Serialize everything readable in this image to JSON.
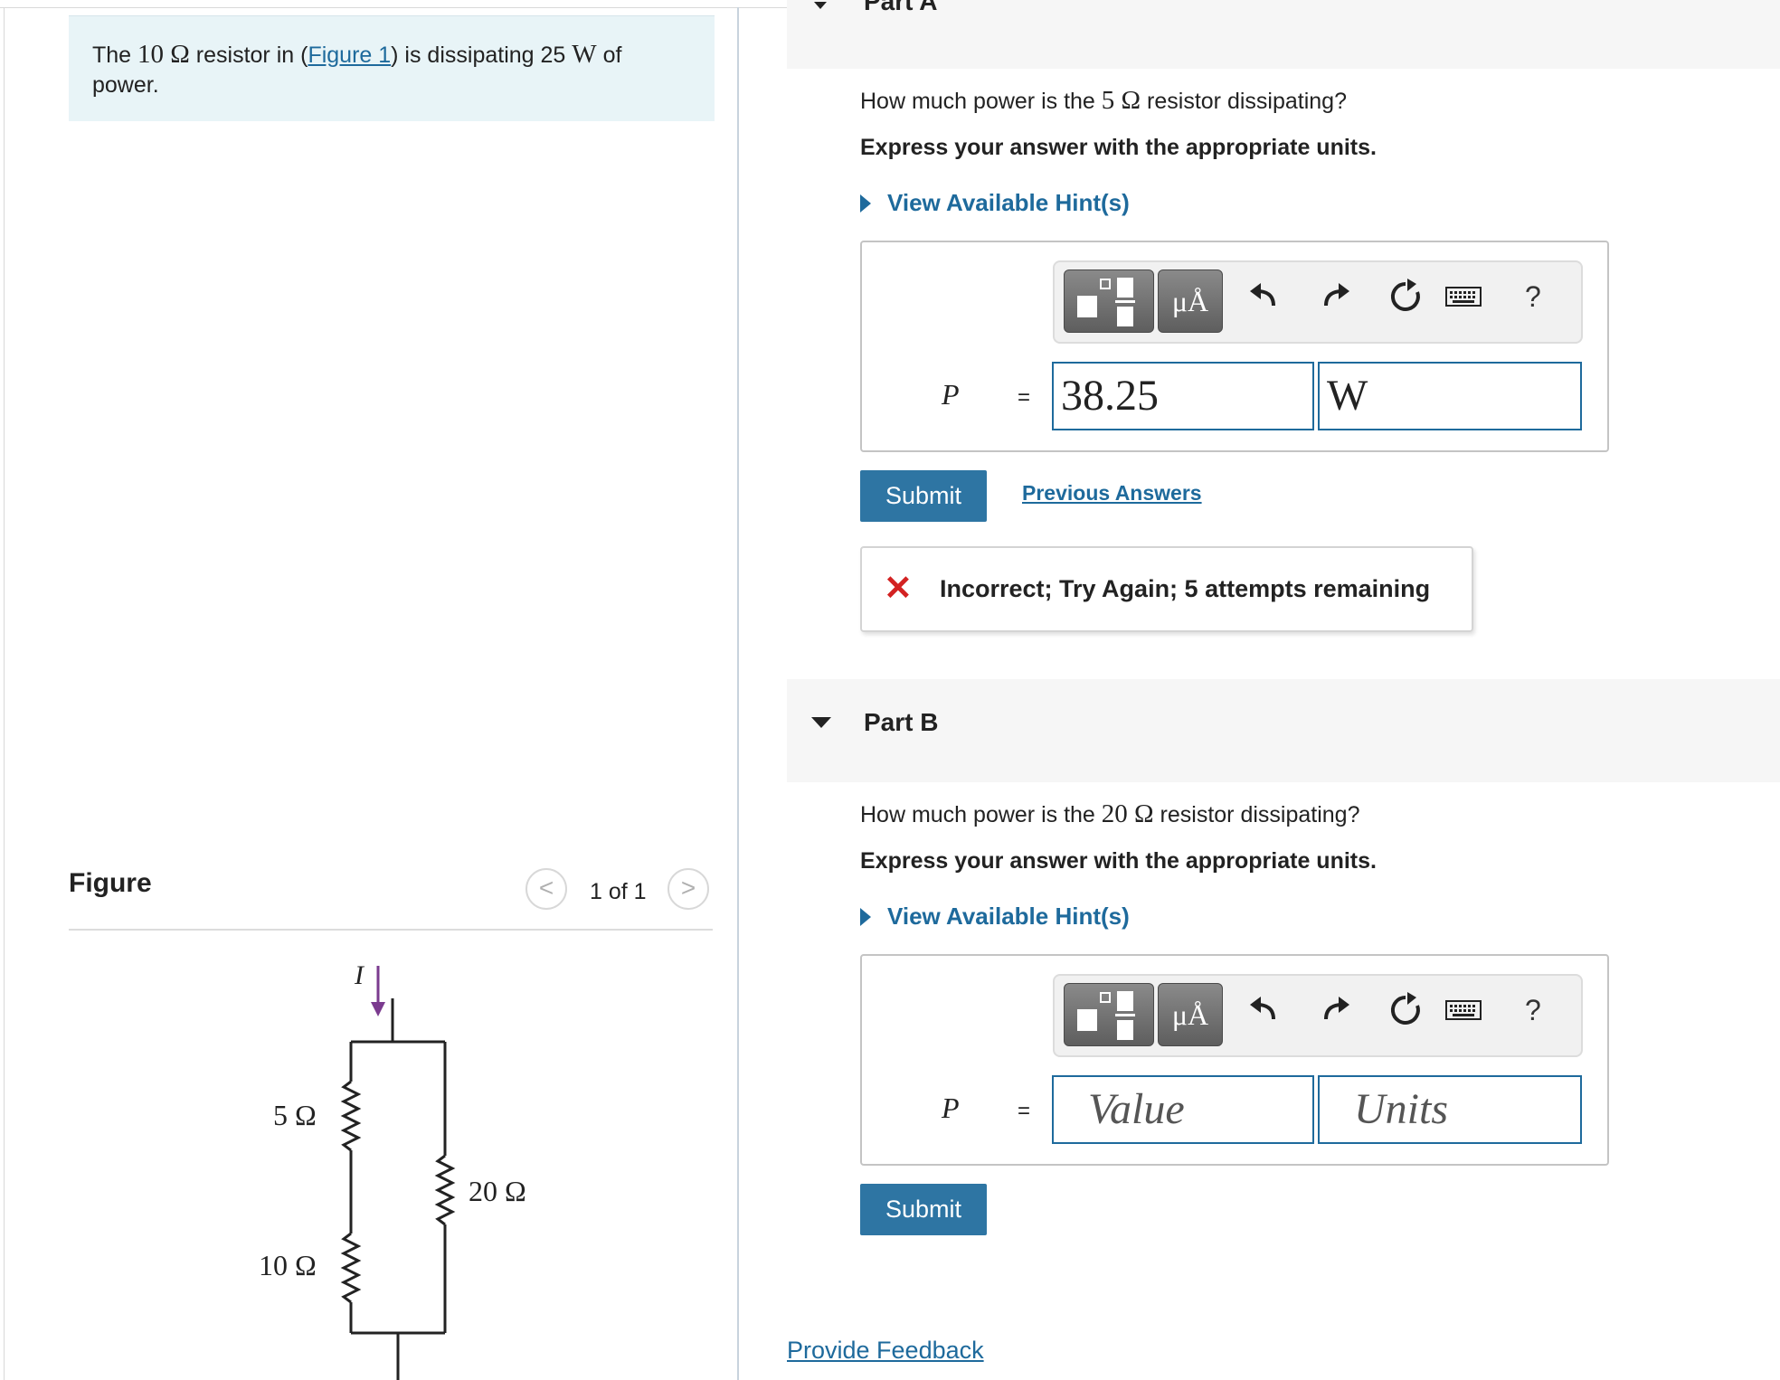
{
  "problem": {
    "text_before": "The ",
    "resistance": "10 Ω",
    "text_middle": " resistor in (",
    "figure_link": "Figure 1",
    "text_after_link": ") is dissipating 25 ",
    "unit_w": "W",
    "text_end": " of power."
  },
  "figure": {
    "title": "Figure",
    "counter": "1 of 1",
    "prev": "<",
    "next": ">",
    "current_label": "I",
    "r1_label": "5 Ω",
    "r2_label": "10 Ω",
    "r3_label": "20 Ω"
  },
  "part_a": {
    "title": "Part A",
    "question_before": "How much power is the ",
    "question_value": "5 Ω",
    "question_after": " resistor dissipating?",
    "express": "Express your answer with the appropriate units.",
    "hint": "View Available Hint(s)",
    "variable": "P",
    "equals": "=",
    "value": "38.25",
    "units": "W",
    "submit": "Submit",
    "previous_answers": "Previous Answers",
    "feedback_icon": "✕",
    "feedback": "Incorrect; Try Again; 5 attempts remaining"
  },
  "part_b": {
    "title": "Part B",
    "question_before": "How much power is the ",
    "question_value": "20 Ω",
    "question_after": " resistor dissipating?",
    "express": "Express your answer with the appropriate units.",
    "hint": "View Available Hint(s)",
    "variable": "P",
    "equals": "=",
    "value_placeholder": "Value",
    "units_placeholder": "Units",
    "submit": "Submit"
  },
  "toolbar": {
    "units_label": "μÅ",
    "help_label": "?",
    "icons": [
      "templates-icon",
      "units-icon",
      "undo-icon",
      "redo-icon",
      "reset-icon",
      "keyboard-icon",
      "help-icon"
    ]
  },
  "footer": {
    "provide_feedback": "Provide Feedback"
  },
  "colors": {
    "link": "#1e6a9c",
    "submit_bg": "#2e75a3",
    "problem_bg": "#e8f4f7",
    "error": "#d32222",
    "current_arrow": "#7b3b8f"
  }
}
